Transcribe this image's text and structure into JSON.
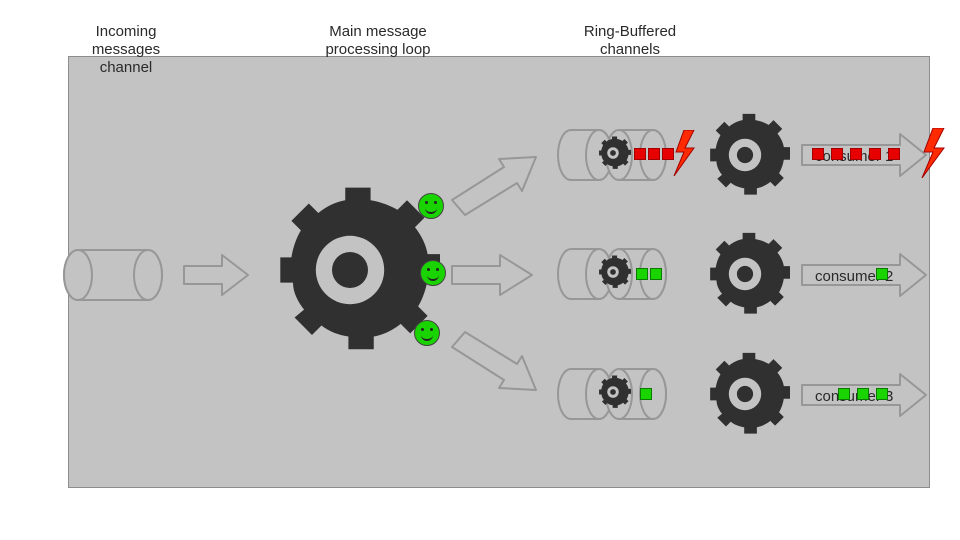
{
  "labels": {
    "incoming": "Incoming\nmessages\nchannel",
    "main_loop": "Main message\nprocessing loop",
    "ring_buffered": "Ring-Buffered\nchannels"
  },
  "consumers": {
    "c1": "consumer 1",
    "c2": "consumer 2",
    "c3": "consumer 3"
  },
  "colors": {
    "canvas": "#c3c3c3",
    "stroke": "#979797",
    "dark": "#303030",
    "green": "#19d400",
    "red": "#e60000"
  },
  "rows": [
    {
      "id": "row1",
      "buffer_squares": [
        "red",
        "red",
        "red"
      ],
      "buffer_bolt": true,
      "output_squares": [
        "red",
        "red",
        "red",
        "red",
        "red"
      ],
      "output_bolt": true
    },
    {
      "id": "row2",
      "buffer_squares": [
        "green",
        "green"
      ],
      "buffer_bolt": false,
      "output_squares": [
        "green"
      ],
      "output_bolt": false
    },
    {
      "id": "row3",
      "buffer_squares": [
        "green"
      ],
      "buffer_bolt": false,
      "output_squares": [
        "green",
        "green",
        "green"
      ],
      "output_bolt": false
    }
  ]
}
